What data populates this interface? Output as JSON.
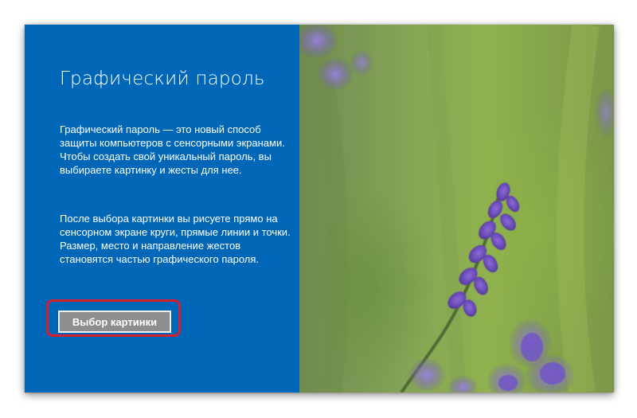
{
  "dialog": {
    "title": "Графический пароль",
    "paragraph_1": "Графический пароль — это новый способ защиты компьютеров с сенсорными экранами. Чтобы создать свой уникальный пароль, вы выбираете картинку и жесты для нее.",
    "paragraph_2": "После выбора картинки вы рисуете прямо на сенсорном экране круги, прямые линии и точки. Размер, место и направление жестов становятся частью графического пароля.",
    "choose_picture_label": "Выбор картинки"
  },
  "colors": {
    "panel_blue": "#0067b8",
    "highlight_red": "#d81e2c",
    "button_gray": "#8e8e8e"
  },
  "image": {
    "subject": "lavender-flower-photo"
  }
}
